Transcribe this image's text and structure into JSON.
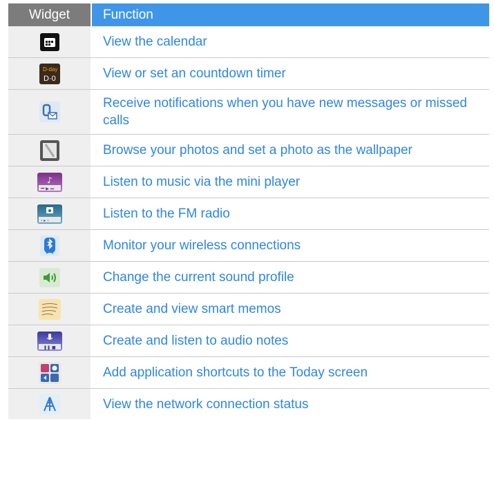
{
  "header": {
    "widget": "Widget",
    "function": "Function"
  },
  "rows": [
    {
      "icon": "calendar-icon",
      "label": "View the calendar"
    },
    {
      "icon": "dday-countdown-icon",
      "label": "View or set an countdown timer"
    },
    {
      "icon": "missed-notification-icon",
      "label": "Receive notifications when you have new messages or missed calls"
    },
    {
      "icon": "photo-frame-icon",
      "label": "Browse your photos and set a photo as the wallpaper"
    },
    {
      "icon": "music-player-icon",
      "label": "Listen to music via the mini player"
    },
    {
      "icon": "fm-radio-icon",
      "label": "Listen to the FM radio"
    },
    {
      "icon": "bluetooth-icon",
      "label": "Monitor your wireless connections"
    },
    {
      "icon": "sound-profile-icon",
      "label": "Change the current sound profile"
    },
    {
      "icon": "smart-memo-icon",
      "label": "Create and view smart memos"
    },
    {
      "icon": "voice-recorder-icon",
      "label": "Create and listen to audio notes"
    },
    {
      "icon": "shortcuts-icon",
      "label": "Add application shortcuts to the Today screen"
    },
    {
      "icon": "network-status-icon",
      "label": "View the network connection status"
    }
  ]
}
